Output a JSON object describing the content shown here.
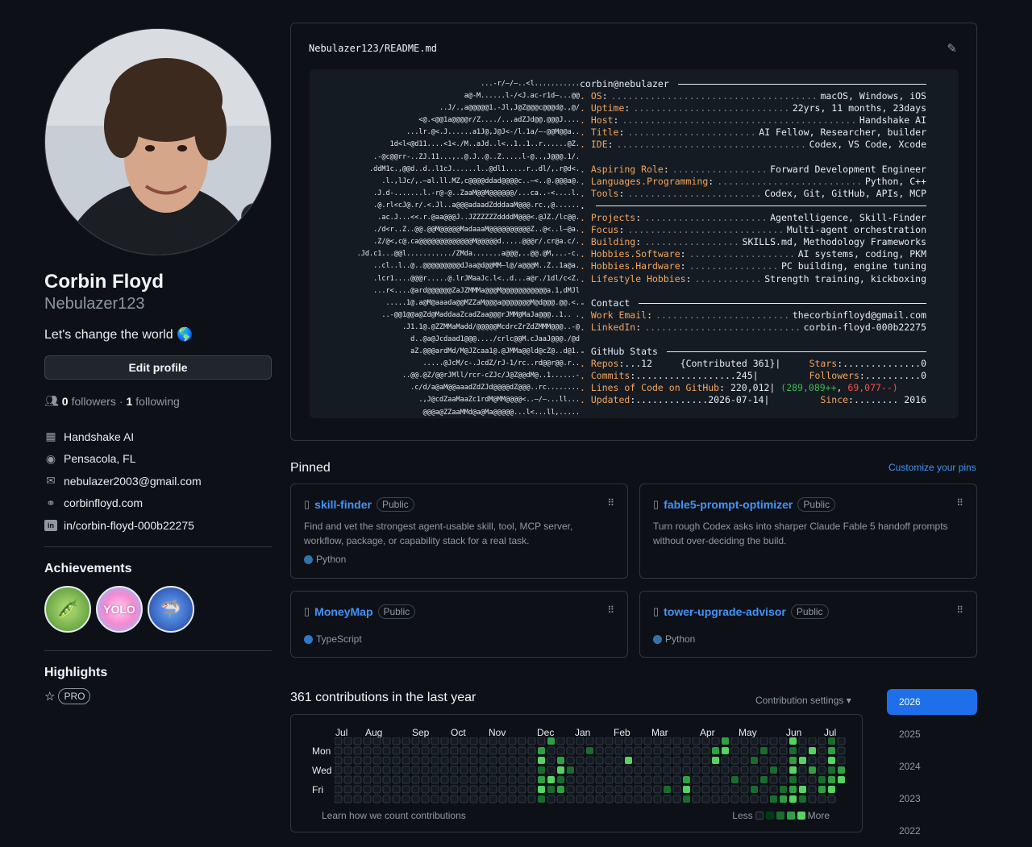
{
  "profile": {
    "name": "Corbin Floyd",
    "login": "Nebulazer123",
    "bio": "Let's change the world 🌎",
    "edit_label": "Edit profile",
    "followers_count": "0",
    "followers_label": "followers",
    "following_count": "1",
    "following_label": "following",
    "company": "Handshake AI",
    "location": "Pensacola, FL",
    "email": "nebulazer2003@gmail.com",
    "website": "corbinfloyd.com",
    "linkedin": "in/corbin-floyd-000b22275"
  },
  "achievements": {
    "title": "Achievements",
    "badges": [
      "pea-pod-icon",
      "yolo-icon",
      "shark-icon"
    ]
  },
  "highlights": {
    "title": "Highlights",
    "pro_label": "PRO"
  },
  "readme": {
    "owner": "Nebulazer123",
    "sep": "/",
    "file": "README.md",
    "header": "corbin@nebulazer",
    "ascii": [
      "...-r/—/—..<l...........",
      "a@-M......l-/<J.ac-r1d—...@@",
      "..J/.,a@@@@@1.-Jl,J@Z@@@c@@@d@.,@/",
      "<@.<@@1a@@@@r/Z..../...adZJd@@.@@@J....",
      "...lr.@<.J......a1J@,J@J<-/l.1a/—-@@M@@a..",
      "1d<l<@d11....<1<./M..aJd..l<..1..1..r......@Z.",
      ".-@c@@rr-..ZJ.11...,..@.J..@..Z.....l-@..,J@@@.1/.",
      ".ddM1c.,@@d..d..l1cJ......l..@dl1.....r..dl/,.r@d<.",
      ".l.,lJc/,.—al.ll.MZ,c@@@@ddad@@@@c..—<..@.@@@a@.",
      ".J.d-.......l.-r@-@..ZaaM@@M@@@@@@/...ca..-<....l.",
      ".@.rl<cJ@.r/.<.Jl..a@@@adaadZdddaaM@@@.rc.,@......",
      ".ac.J...<<.r.@aa@@@J..JZZZZZZddddM@@@<.@JZ./lc@@.",
      "./d<r..Z..@@.@@M@@@@@MadaaaM@@@@@@@@@@Z..@<..l—@a.",
      ".Z/@<,c@.ca@@@@@@@@@@@@@M@@@@@d.....@@@r/.cr@a.c/.",
      ".Jd.c1...@@l.........../ZMda.......a@@@,..@@.@M,...-c.",
      "..cl..l..@..@@@@@@@@@dJaa@d@@MM—l@/a@@@M..Z..1a@a.",
      ".lcr1....@@@r.....@.lrJMaaJc.l<..d...a@r./1dl/c<Z.",
      "...r<....@ard@@@@@@ZaJZMMMa@@@M@@@@@@@@@@@a.1,dMJl",
      ".....1@.a@M@aaada@@MZZaM@@@a@@@@@@@M@d@@@.@@.<.",
      "..-@@1@@a@Zd@MaddaaZcadZaa@@@rJMM@MaJa@@@..1.. .",
      ".J1.1@.@ZZMMaMadd/@@@@@McdrcZrZdZMMM@@@..-@",
      "d..@a@Jcdaad1@@@..../crlc@@M.cJaaJ@@@./@d",
      "aZ.@@@ardMd/M@JZcaa1@.@JMMa@@ld@cZ@..d@1.",
      ".....@JcM/c-.JcdZ/rJ-1/rc..rd@@r@@.r..",
      "..@@.@Z/@@rJMll/rcr-cZJc/J@Z@@dM@..1......-",
      ".c/d/a@aM@@aaadZdZJd@@@@dZ@@@..rc........",
      ".,J@cdZaaMaaZc1rdM@MM@@@@<..—/—...ll...",
      "@@@a@ZZaaMMd@a@Ma@@@@@...l<...ll,.....",
      "...@@@@@@@@@@@@@@@/...<<<...llllll,.",
      "...@Zld@@@@@@@@@M<.<..,<l..llllllll.",
      ".....@@<,........./@@..,l,..<lll,....,l.",
      "..l.....@cJ@@@JJJrr@@..<..,..l,.—,..,,...",
      "..l.......M@rlrllJda@@..<<...,...,<..,....",
      "...........@@cJZ@@@@@@.l<<...l,,l,<<.....",
      "....l,...........@@@@@1.....l<...—lll<1l/—....",
      "..................................................l."
    ],
    "rows": [
      {
        "k": "OS",
        "v": "macOS, Windows, iOS"
      },
      {
        "k": "Uptime",
        "v": "22yrs, 11 months, 23days"
      },
      {
        "k": "Host",
        "v": "Handshake AI"
      },
      {
        "k": "Title",
        "v": "AI Fellow, Researcher, builder"
      },
      {
        "k": "IDE",
        "v": "Codex, VS Code, Xcode"
      },
      {
        "k": "Aspiring Role",
        "v": "Forward Development Engineer"
      },
      {
        "k": "Languages.Programming",
        "v": "Python, C++"
      },
      {
        "k": "Tools",
        "v": "Codex, Git, GitHub, APIs, MCP"
      },
      {
        "k": "Projects",
        "v": "Agentelligence, Skill-Finder"
      },
      {
        "k": "Focus",
        "v": "Multi-agent orchestration"
      },
      {
        "k": "Building",
        "v": "SKILLS.md, Methodology Frameworks"
      },
      {
        "k": "Hobbies.Software",
        "v": "AI systems, coding, PKM"
      },
      {
        "k": "Hobbies.Hardware",
        "v": "PC building, engine tuning"
      },
      {
        "k": "Lifestyle Hobbies",
        "v": "Strength training, kickboxing"
      }
    ],
    "contact_title": "Contact",
    "contact": [
      {
        "k": "Work Email",
        "v": "thecorbinfloyd@gmail.com"
      },
      {
        "k": "LinkedIn",
        "v": "corbin-floyd-000b22275"
      }
    ],
    "stats_title": "GitHub Stats",
    "stats": {
      "repos_k": "Repos",
      "repos_v": "12",
      "contributed_k": "{Contributed",
      "contributed_v": "361}",
      "stars_k": "Stars",
      "stars_v": "0",
      "commits_k": "Commits",
      "commits_v": "245",
      "followers_k": "Followers",
      "followers_v": "0",
      "loc_k": "Lines of Code on GitHub",
      "loc_v": "220,012",
      "loc_add": "(289,089++",
      "loc_del": "69,077--)",
      "updated_k": "Updated",
      "updated_v": "2026-07-14",
      "since_k": "Since",
      "since_v": "2016"
    }
  },
  "pinned": {
    "title": "Pinned",
    "customize": "Customize your pins",
    "public_label": "Public",
    "cards": [
      {
        "name": "skill-finder",
        "desc": "Find and vet the strongest agent-usable skill, tool, MCP server, workflow, package, or capability stack for a real task.",
        "lang": "Python",
        "color": "#3572A5"
      },
      {
        "name": "fable5-prompt-optimizer",
        "desc": "Turn rough Codex asks into sharper Claude Fable 5 handoff prompts without over-deciding the build.",
        "lang": "",
        "color": ""
      },
      {
        "name": "MoneyMap",
        "desc": "",
        "lang": "TypeScript",
        "color": "#3178c6"
      },
      {
        "name": "tower-upgrade-advisor",
        "desc": "",
        "lang": "Python",
        "color": "#3572A5"
      }
    ]
  },
  "contrib": {
    "title": "361 contributions in the last year",
    "settings": "Contribution settings",
    "months": [
      "Jul",
      "Aug",
      "Sep",
      "Oct",
      "Nov",
      "Dec",
      "Jan",
      "Feb",
      "Mar",
      "Apr",
      "May",
      "Jun",
      "Jul"
    ],
    "days": [
      "Mon",
      "Wed",
      "Fri"
    ],
    "learn": "Learn how we count contributions",
    "less": "Less",
    "more": "More",
    "years": [
      "2026",
      "2025",
      "2024",
      "2023",
      "2022"
    ],
    "colors": [
      "#151b23",
      "#033a16",
      "#196c2e",
      "#2ea043",
      "#56d364"
    ]
  }
}
